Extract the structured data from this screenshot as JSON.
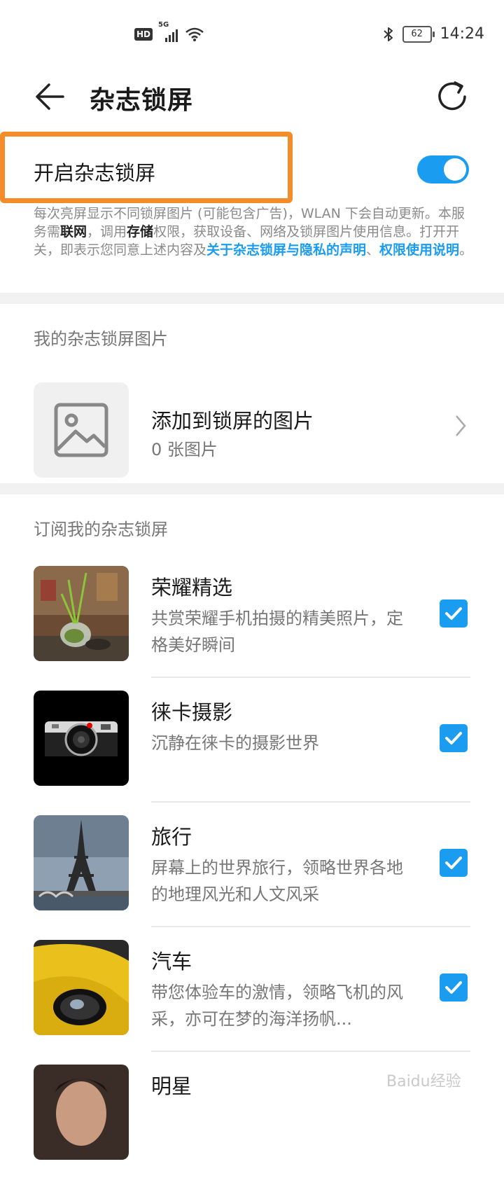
{
  "status_bar": {
    "hd": "HD",
    "network": "5G",
    "battery": "62",
    "time": "14:24"
  },
  "app_bar": {
    "title": "杂志锁屏"
  },
  "master": {
    "label": "开启杂志锁屏",
    "enabled": true
  },
  "description": {
    "p1": "每次亮屏显示不同锁屏图片 (可能包含广告)，WLAN 下会自动更新。本服务需",
    "b1": "联网",
    "p2": "，调用",
    "b2": "存储",
    "p3": "权限，获取设备、网络及锁屏图片使用信息。打开开关，即表示您同意上述内容及",
    "link1": "关于杂志锁屏与隐私的声明",
    "p4": "、",
    "link2": "权限使用说明",
    "p5": "。"
  },
  "my_pictures": {
    "header": "我的杂志锁屏图片",
    "add_title": "添加到锁屏的图片",
    "add_count": "0 张图片"
  },
  "subscriptions": {
    "header": "订阅我的杂志锁屏",
    "items": [
      {
        "title": "荣耀精选",
        "desc": "共赏荣耀手机拍摄的精美照片，定格美好瞬间",
        "checked": true,
        "thumb": "plant-photo"
      },
      {
        "title": "徕卡摄影",
        "desc": "沉静在徕卡的摄影世界",
        "checked": true,
        "thumb": "camera-photo"
      },
      {
        "title": "旅行",
        "desc": "屏幕上的世界旅行，领略世界各地的地理风光和人文风采",
        "checked": true,
        "thumb": "eiffel-photo"
      },
      {
        "title": "汽车",
        "desc": "带您体验车的激情，领略飞机的风采，亦可在梦的海洋扬帆...",
        "checked": true,
        "thumb": "car-photo"
      },
      {
        "title": "明星",
        "desc": "",
        "checked": true,
        "thumb": "portrait-photo"
      }
    ]
  },
  "watermark": "Baidu经验",
  "colors": {
    "accent": "#1a9df0",
    "highlight": "#f58c2a"
  }
}
